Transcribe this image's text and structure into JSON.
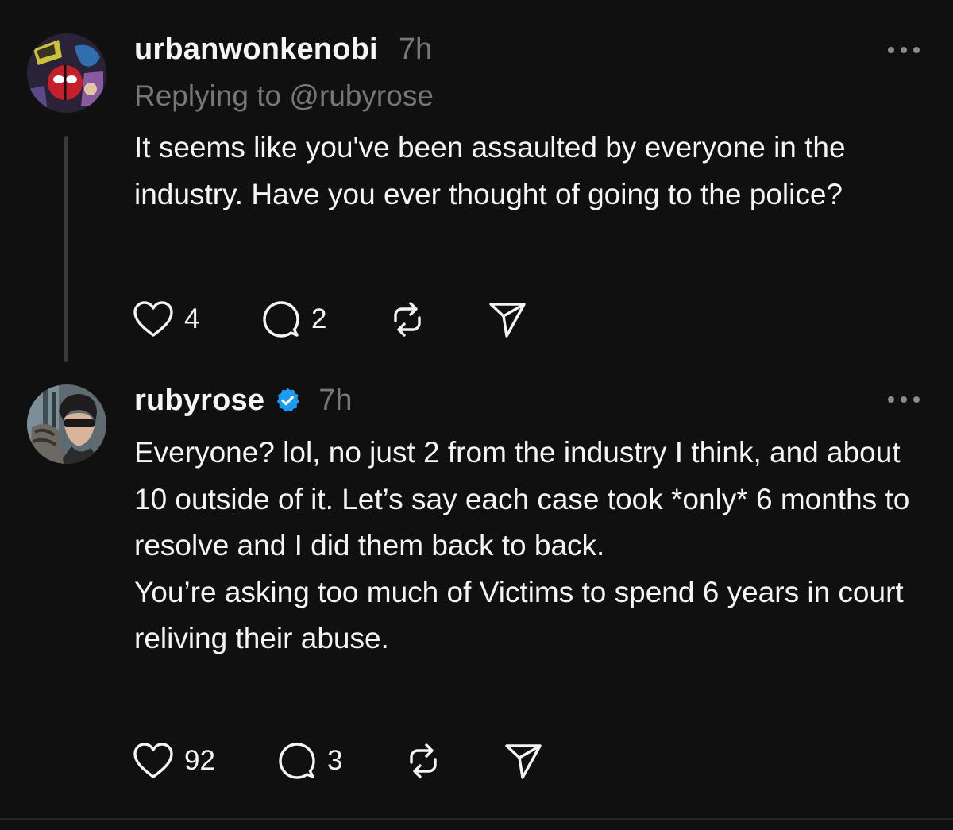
{
  "posts": [
    {
      "username": "urbanwonkenobi",
      "verified": false,
      "time": "7h",
      "reply_to": "Replying to @rubyrose",
      "paragraphs": [
        "It seems like you've been assaulted by everyone in the industry. Have you ever thought of going to the police?"
      ],
      "likes": "4",
      "replies": "2"
    },
    {
      "username": "rubyrose",
      "verified": true,
      "time": "7h",
      "paragraphs": [
        "Everyone? lol, no just 2 from the industry I think, and about 10 outside of it. Let’s say each case took *only* 6 months to resolve and I did them back to back.",
        "You’re asking too much of Victims to spend 6 years in court reliving their abuse."
      ],
      "likes": "92",
      "replies": "3"
    }
  ],
  "icons": {
    "like": "heart-icon",
    "reply": "comment-bubble-icon",
    "repost": "repost-icon",
    "share": "send-icon",
    "more": "more-horizontal-icon",
    "verified": "verified-badge-icon"
  },
  "colors": {
    "background": "#101010",
    "primary_text": "#f3f5f7",
    "secondary_text": "#777777",
    "verified": "#1d9bf0",
    "thread_line": "#3a3a3a"
  }
}
